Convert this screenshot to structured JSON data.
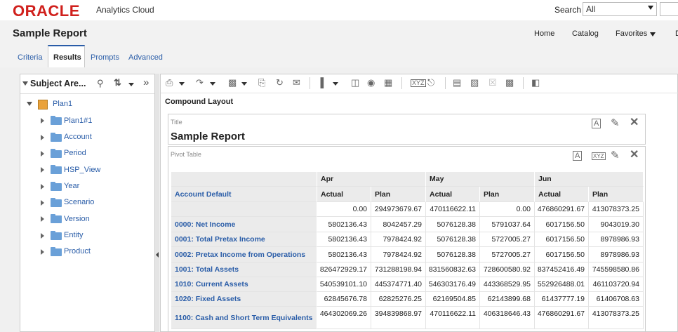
{
  "header": {
    "logo": "ORACLE",
    "product": "Analytics Cloud",
    "search_label": "Search",
    "search_scope": "All"
  },
  "titlebar": {
    "title": "Sample Report",
    "nav": [
      "Home",
      "Catalog",
      "Favorites"
    ],
    "nav_cut": "D"
  },
  "tabs": [
    {
      "label": "Criteria",
      "active": false
    },
    {
      "label": "Results",
      "active": true
    },
    {
      "label": "Prompts",
      "active": false
    },
    {
      "label": "Advanced",
      "active": false
    }
  ],
  "left_panel": {
    "title": "Subject Are...",
    "root": "Plan1",
    "items": [
      "Plan1#1",
      "Account",
      "Period",
      "HSP_View",
      "Year",
      "Scenario",
      "Version",
      "Entity",
      "Product"
    ]
  },
  "editor": {
    "compound_label": "Compound Layout",
    "title_view": {
      "caption": "Title",
      "text": "Sample Report"
    },
    "pivot_view": {
      "caption": "Pivot Table"
    }
  },
  "pivot": {
    "corner": "Account Default",
    "months": [
      "Apr",
      "May",
      "Jun"
    ],
    "measures": [
      "Actual",
      "Plan"
    ],
    "rows": [
      {
        "label": "",
        "values": [
          "0.00",
          "294973679.67",
          "470116622.11",
          "0.00",
          "476860291.67",
          "413078373.25"
        ]
      },
      {
        "label": "0000: Net Income",
        "values": [
          "5802136.43",
          "8042457.29",
          "5076128.38",
          "5791037.64",
          "6017156.50",
          "9043019.30"
        ]
      },
      {
        "label": "0001: Total Pretax Income",
        "values": [
          "5802136.43",
          "7978424.92",
          "5076128.38",
          "5727005.27",
          "6017156.50",
          "8978986.93"
        ]
      },
      {
        "label": "0002: Pretax Income from Operations",
        "values": [
          "5802136.43",
          "7978424.92",
          "5076128.38",
          "5727005.27",
          "6017156.50",
          "8978986.93"
        ]
      },
      {
        "label": "1001: Total Assets",
        "values": [
          "826472929.17",
          "731288198.94",
          "831560832.63",
          "728600580.92",
          "837452416.49",
          "745598580.86"
        ]
      },
      {
        "label": "1010: Current Assets",
        "values": [
          "540539101.10",
          "445374771.40",
          "546303176.49",
          "443368529.95",
          "552926488.01",
          "461103720.94"
        ]
      },
      {
        "label": "1020: Fixed Assets",
        "values": [
          "62845676.78",
          "62825276.25",
          "62169504.85",
          "62143899.68",
          "61437777.19",
          "61406708.63"
        ]
      },
      {
        "label": "1100: Cash and Short Term Equivalents",
        "values": [
          "464302069.26",
          "394839868.97",
          "470116622.11",
          "406318646.43",
          "476860291.67",
          "413078373.25"
        ]
      }
    ]
  },
  "colors": {
    "oracle_red": "#d0201c",
    "link_blue": "#2a5da8",
    "header_gray": "#ebebeb"
  }
}
